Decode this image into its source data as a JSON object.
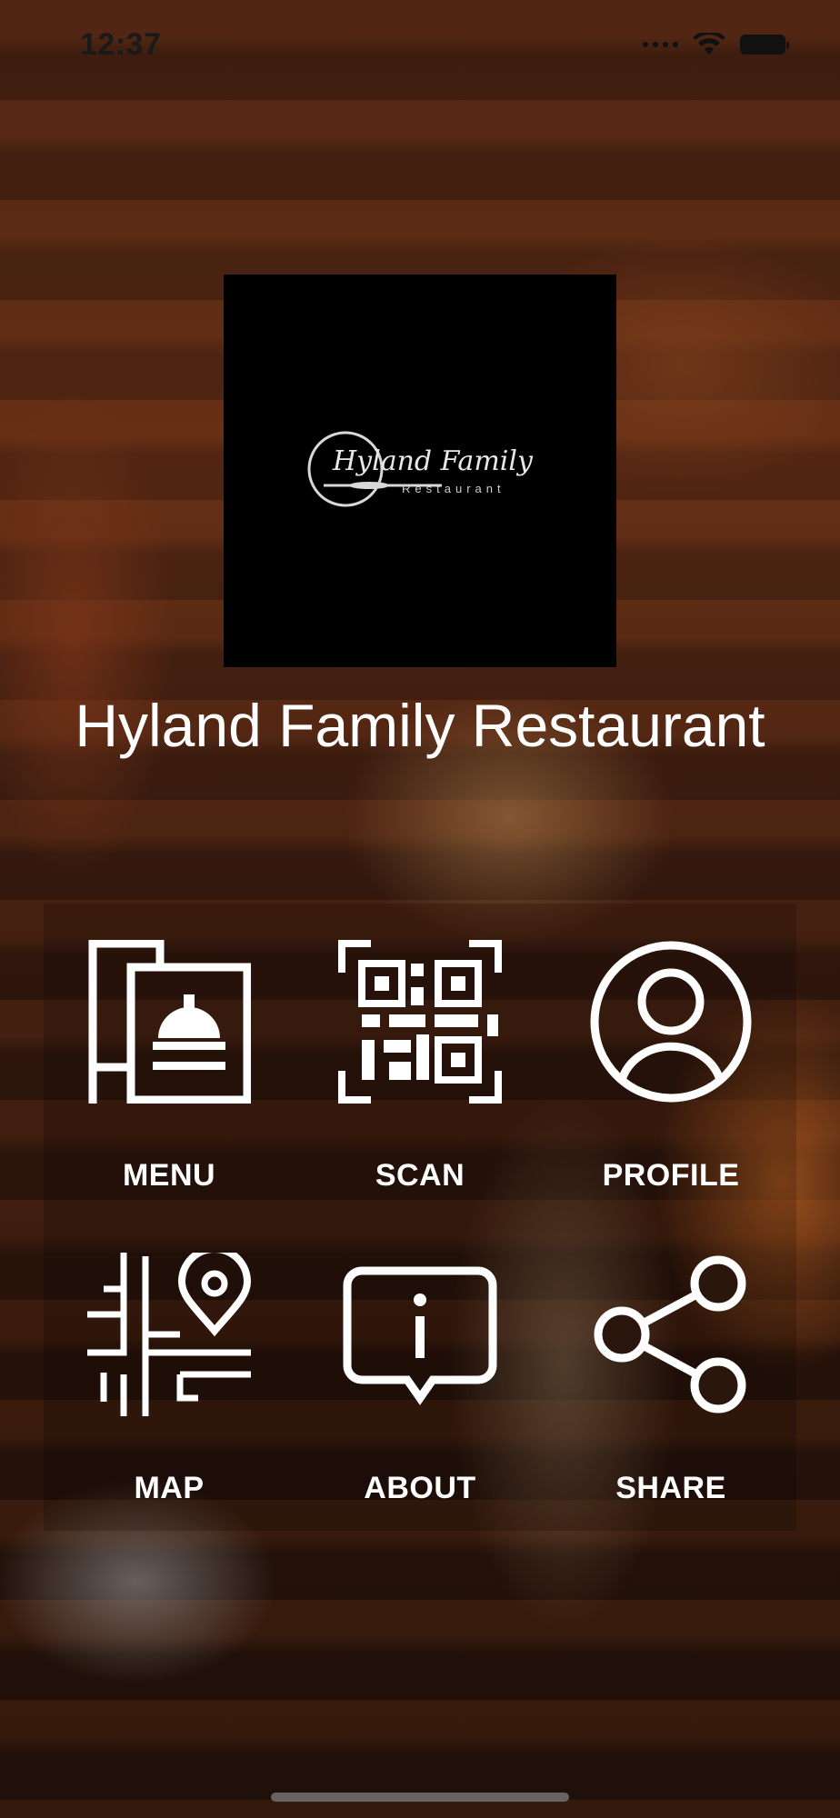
{
  "status_bar": {
    "time": "12:37",
    "icons": [
      "cellular-signal-icon",
      "wifi-icon",
      "battery-icon"
    ]
  },
  "logo": {
    "line1": "Hyland Family",
    "line2": "Restaurant"
  },
  "restaurant_name": "Hyland Family Restaurant",
  "menu_tiles": [
    {
      "label": "MENU",
      "icon": "menu-cloche-icon"
    },
    {
      "label": "SCAN",
      "icon": "qr-code-icon"
    },
    {
      "label": "PROFILE",
      "icon": "user-profile-icon"
    },
    {
      "label": "MAP",
      "icon": "map-pin-icon"
    },
    {
      "label": "ABOUT",
      "icon": "info-bubble-icon"
    },
    {
      "label": "SHARE",
      "icon": "share-icon"
    }
  ],
  "colors": {
    "tile_foreground": "#ffffff",
    "logo_background": "#000000"
  }
}
